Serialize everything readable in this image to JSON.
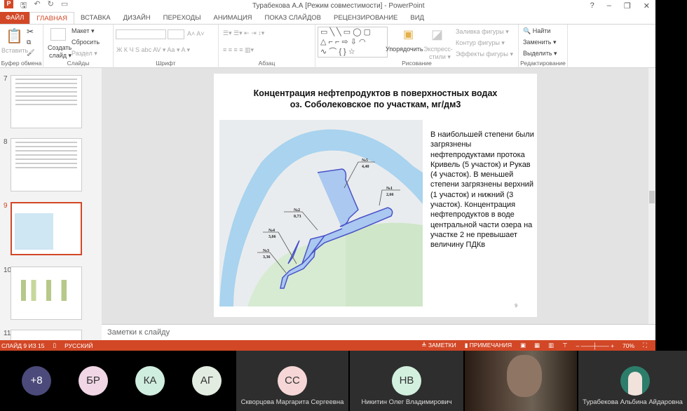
{
  "window": {
    "title": "Турабекова А.А [Режим совместимости] - PowerPoint",
    "help": "?",
    "minimize": "–",
    "restore": "❐",
    "close": "✕"
  },
  "tabs": [
    "ФАЙЛ",
    "ГЛАВНАЯ",
    "ВСТАВКА",
    "ДИЗАЙН",
    "ПЕРЕХОДЫ",
    "АНИМАЦИЯ",
    "ПОКАЗ СЛАЙДОВ",
    "РЕЦЕНЗИРОВАНИЕ",
    "ВИД"
  ],
  "ribbon": {
    "clipboard": {
      "paste": "Вставить",
      "label": "Буфер обмена"
    },
    "slides": {
      "create": "Создать",
      "create2": "слайд ▾",
      "layout": "Макет ▾",
      "reset": "Сбросить",
      "section": "Раздел ▾",
      "label": "Слайды"
    },
    "font": {
      "buttons": "Ж  К  Ч  S  abc  AV ▾  Aa ▾   A ▾",
      "label": "Шрифт"
    },
    "paragraph": {
      "label": "Абзац"
    },
    "drawing": {
      "arrange": "Упорядочить",
      "styles": "Экспресс-",
      "styles2": "стили ▾",
      "fill": "Заливка фигуры ▾",
      "outline": "Контур фигуры ▾",
      "effects": "Эффекты фигуры ▾",
      "label": "Рисование"
    },
    "editing": {
      "find": "Найти",
      "replace": "Заменить ▾",
      "select": "Выделить ▾",
      "label": "Редактирование"
    }
  },
  "thumbnails": [
    {
      "num": "7"
    },
    {
      "num": "8"
    },
    {
      "num": "9"
    },
    {
      "num": "10"
    },
    {
      "num": "11"
    }
  ],
  "slide": {
    "title_line1": "Концентрация нефтепродуктов в поверхностных водах",
    "title_line2": "оз. Соболековское по участкам, мг/дм3",
    "text": "В наибольшей степени были загрязнены нефтепродуктами протока Кривель (5 участок) и Рукав (4 участок). В меньшей степени загрязнены верхний (1 участок) и нижний (3 участок). Концентрация нефтепродуктов в воде центральной части озера на участке 2 не превышает величину ПДКв",
    "number": "9",
    "map_labels": [
      {
        "id": "№5",
        "value": "4,40"
      },
      {
        "id": "№1",
        "value": "2,66"
      },
      {
        "id": "№2",
        "value": "0,73"
      },
      {
        "id": "№4",
        "value": "3,66"
      },
      {
        "id": "№3",
        "value": "3,36"
      }
    ]
  },
  "notes_placeholder": "Заметки к слайду",
  "status": {
    "slide": "СЛАЙД 9 ИЗ 15",
    "lang": "РУССКИЙ",
    "notes": "≜ ЗАМЕТКИ",
    "comments": "▮ ПРИМЕЧАНИЯ",
    "zoom": "70%"
  },
  "participants": [
    {
      "initials": "+8",
      "color": "#4b4a7a"
    },
    {
      "initials": "БР",
      "color": "#f1d6e6"
    },
    {
      "initials": "КА",
      "color": "#cfeee0"
    },
    {
      "initials": "АГ",
      "color": "#e2ece0"
    },
    {
      "initials": "СС",
      "color": "#f6d6d6",
      "name": "Скворцова Маргарита Сергеевна"
    },
    {
      "initials": "НВ",
      "color": "#d3f0df",
      "name": "Никитин Олег Владимирович"
    },
    {
      "name": "Турабекова Альбина Айдаровна"
    }
  ]
}
